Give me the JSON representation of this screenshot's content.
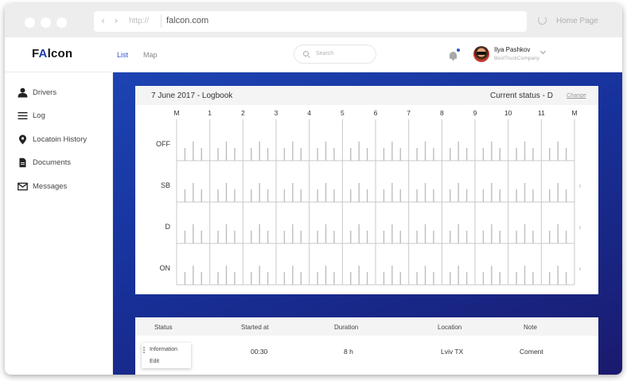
{
  "browser": {
    "url_protocol": "http://",
    "url": "falcon.com",
    "home_label": "Home Page",
    "nav_arrows": "‹ ›"
  },
  "header": {
    "logo_prefix": "F",
    "logo_accent": "A",
    "logo_suffix": "lcon",
    "tabs": [
      {
        "label": "List",
        "active": true
      },
      {
        "label": "Map",
        "active": false
      }
    ],
    "search_placeholder": "Search",
    "user": {
      "name": "Ilya Pashkov",
      "company": "BestTruckCompany"
    }
  },
  "sidebar": {
    "items": [
      {
        "label": "Drivers",
        "icon": "user-icon"
      },
      {
        "label": "Log",
        "icon": "menu-icon"
      },
      {
        "label": "Locatoin History",
        "icon": "map-pin-icon"
      },
      {
        "label": "Documents",
        "icon": "document-icon"
      },
      {
        "label": "Messages",
        "icon": "mail-icon"
      }
    ]
  },
  "logbook": {
    "title": "7 June 2017  - Logbook",
    "status": "Current status - D",
    "change_label": "Change",
    "hours": [
      "M",
      "1",
      "2",
      "3",
      "4",
      "5",
      "6",
      "7",
      "8",
      "9",
      "10",
      "11",
      "M"
    ],
    "rows": [
      "OFF",
      "SB",
      "D",
      "ON"
    ]
  },
  "table": {
    "columns": [
      "Status",
      "Started at",
      "Duration",
      "Location",
      "Note"
    ],
    "row": {
      "started_at": "00:30",
      "duration": "8 h",
      "location": "Lviv TX",
      "note": "Coment"
    },
    "menu": [
      "Information",
      "Edit"
    ]
  },
  "colors": {
    "accent": "#2f56c6",
    "main_bg_start": "#1d44b3",
    "main_bg_end": "#1a1a6e"
  }
}
